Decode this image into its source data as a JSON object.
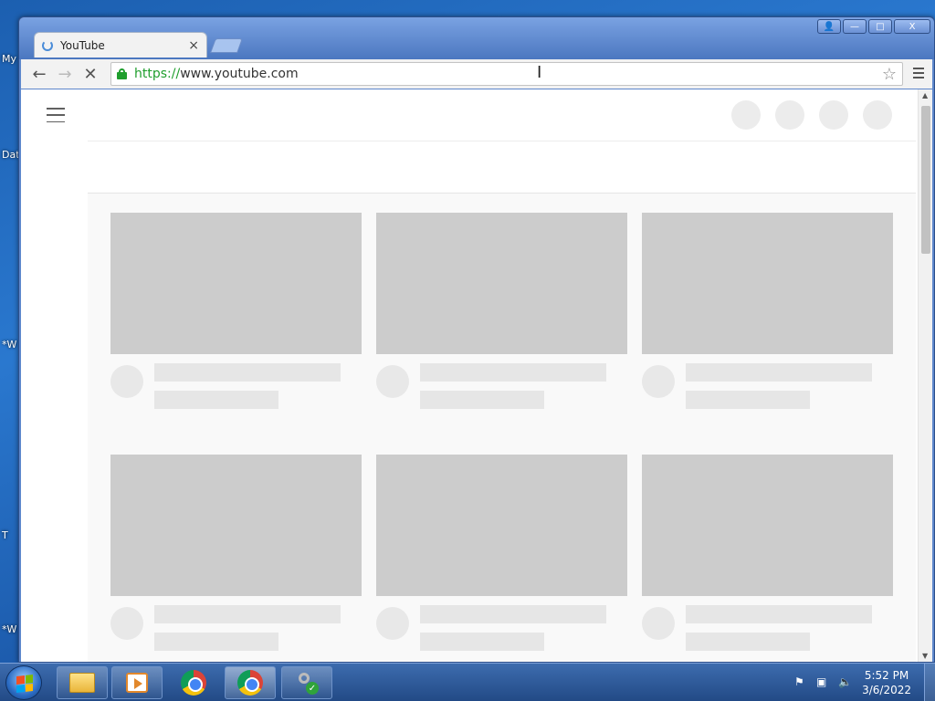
{
  "desktop": {
    "labels": [
      "My",
      "Dat",
      "*W",
      "T",
      "*W"
    ]
  },
  "browser": {
    "tab": {
      "title": "YouTube",
      "close": "×"
    },
    "window_buttons": {
      "user": "👤",
      "minimize": "—",
      "maximize": "□",
      "close": "X"
    },
    "nav": {
      "back": "←",
      "forward": "→",
      "stop": "✕"
    },
    "address": {
      "scheme": "https://",
      "rest": "www.youtube.com"
    },
    "star": "☆",
    "cursor": "I"
  },
  "taskbar": {
    "clock_time": "5:52 PM",
    "clock_date": "3/6/2022"
  }
}
